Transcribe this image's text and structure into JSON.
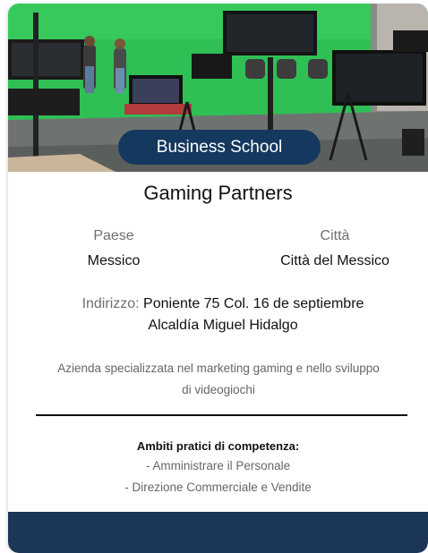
{
  "card": {
    "badge": "Business School",
    "company_name": "Gaming Partners",
    "country_label": "Paese",
    "country_value": "Messico",
    "city_label": "Città",
    "city_value": "Città del Messico",
    "address_label": "Indirizzo:",
    "address_line1": "Poniente 75 Col. 16 de septiembre",
    "address_line2": "Alcaldía Miguel Hidalgo",
    "description": "Azienda specializzata nel marketing gaming e nello sviluppo di videogiochi",
    "skills_title": "Ambiti pratici di competenza:",
    "skills": [
      "- Amministrare il Personale",
      "- Direzione Commerciale e Vendite"
    ]
  },
  "colors": {
    "badge_bg": "#15385f",
    "footer_bg": "#1b3656",
    "green_screen": "#2fbf55"
  }
}
